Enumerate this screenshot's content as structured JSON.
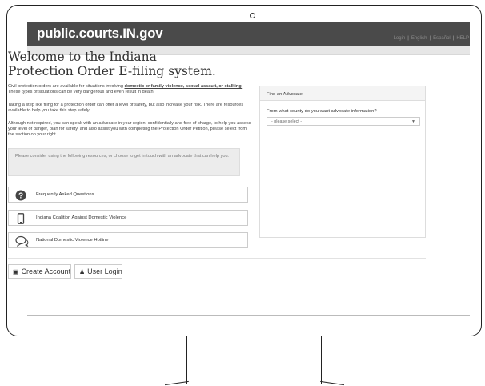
{
  "site": {
    "brand": "public.courts.IN.gov"
  },
  "toplinks": [
    "Login",
    "English",
    "Español",
    "HELP"
  ],
  "welcome": {
    "line1": "Welcome to the Indiana",
    "line2": "Protection Order E-filing system."
  },
  "intro": {
    "p1_start": "Civil protection orders are available for situations involving ",
    "p1_link": "domestic or family violence, sexual assault, or stalking.",
    "p1_end": " These types of situations can be very dangerous and even result in death.",
    "p2": "Taking a step like filing for a protection order can offer a level of safety, but also increase your risk. There are resources available to help you take this step safely.",
    "p3": "Although not required, you can speak with an advocate in your region, confidentially and free of charge, to help you assess your level of danger, plan for safety, and also assist you with completing the Protection Order Petition, please select from the section on your right."
  },
  "consider": "Please consider using the following resources, or choose to get in touch with an advocate that can help you:",
  "resources": [
    {
      "label": "Frequently Asked Questions",
      "icon": "question-circle-icon"
    },
    {
      "label": "Indiana Coalition Against Domestic Violence",
      "icon": "mobile-phone-icon"
    },
    {
      "label": "National Domestic Violence Hotline",
      "icon": "chat-bubbles-icon"
    }
  ],
  "advocate": {
    "title": "Find an Advocate",
    "question": "From what county do you want advocate information?",
    "select_value": "- please select -"
  },
  "buttons": {
    "create": "Create Account",
    "login": "User Login"
  },
  "colors": {
    "header": "#4a4a4a",
    "panel": "#ececec"
  }
}
